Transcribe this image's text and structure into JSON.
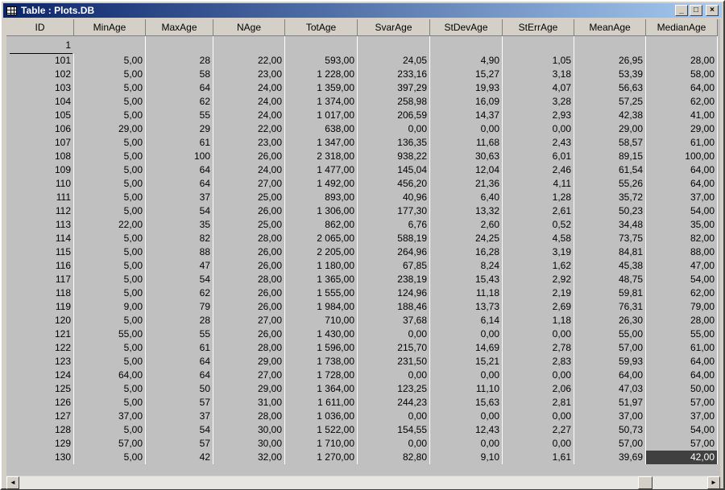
{
  "window": {
    "title": "Table : Plots.DB",
    "minimize": "_",
    "maximize": "□",
    "close": "×"
  },
  "table": {
    "columns": [
      "ID",
      "MinAge",
      "MaxAge",
      "NAge",
      "TotAge",
      "SvarAge",
      "StDevAge",
      "StErrAge",
      "MeanAge",
      "MedianAge"
    ],
    "id_header_value": "1",
    "rows": [
      [
        "101",
        "5,00",
        "28",
        "22,00",
        "593,00",
        "24,05",
        "4,90",
        "1,05",
        "26,95",
        "28,00"
      ],
      [
        "102",
        "5,00",
        "58",
        "23,00",
        "1 228,00",
        "233,16",
        "15,27",
        "3,18",
        "53,39",
        "58,00"
      ],
      [
        "103",
        "5,00",
        "64",
        "24,00",
        "1 359,00",
        "397,29",
        "19,93",
        "4,07",
        "56,63",
        "64,00"
      ],
      [
        "104",
        "5,00",
        "62",
        "24,00",
        "1 374,00",
        "258,98",
        "16,09",
        "3,28",
        "57,25",
        "62,00"
      ],
      [
        "105",
        "5,00",
        "55",
        "24,00",
        "1 017,00",
        "206,59",
        "14,37",
        "2,93",
        "42,38",
        "41,00"
      ],
      [
        "106",
        "29,00",
        "29",
        "22,00",
        "638,00",
        "0,00",
        "0,00",
        "0,00",
        "29,00",
        "29,00"
      ],
      [
        "107",
        "5,00",
        "61",
        "23,00",
        "1 347,00",
        "136,35",
        "11,68",
        "2,43",
        "58,57",
        "61,00"
      ],
      [
        "108",
        "5,00",
        "100",
        "26,00",
        "2 318,00",
        "938,22",
        "30,63",
        "6,01",
        "89,15",
        "100,00"
      ],
      [
        "109",
        "5,00",
        "64",
        "24,00",
        "1 477,00",
        "145,04",
        "12,04",
        "2,46",
        "61,54",
        "64,00"
      ],
      [
        "110",
        "5,00",
        "64",
        "27,00",
        "1 492,00",
        "456,20",
        "21,36",
        "4,11",
        "55,26",
        "64,00"
      ],
      [
        "111",
        "5,00",
        "37",
        "25,00",
        "893,00",
        "40,96",
        "6,40",
        "1,28",
        "35,72",
        "37,00"
      ],
      [
        "112",
        "5,00",
        "54",
        "26,00",
        "1 306,00",
        "177,30",
        "13,32",
        "2,61",
        "50,23",
        "54,00"
      ],
      [
        "113",
        "22,00",
        "35",
        "25,00",
        "862,00",
        "6,76",
        "2,60",
        "0,52",
        "34,48",
        "35,00"
      ],
      [
        "114",
        "5,00",
        "82",
        "28,00",
        "2 065,00",
        "588,19",
        "24,25",
        "4,58",
        "73,75",
        "82,00"
      ],
      [
        "115",
        "5,00",
        "88",
        "26,00",
        "2 205,00",
        "264,96",
        "16,28",
        "3,19",
        "84,81",
        "88,00"
      ],
      [
        "116",
        "5,00",
        "47",
        "26,00",
        "1 180,00",
        "67,85",
        "8,24",
        "1,62",
        "45,38",
        "47,00"
      ],
      [
        "117",
        "5,00",
        "54",
        "28,00",
        "1 365,00",
        "238,19",
        "15,43",
        "2,92",
        "48,75",
        "54,00"
      ],
      [
        "118",
        "5,00",
        "62",
        "26,00",
        "1 555,00",
        "124,96",
        "11,18",
        "2,19",
        "59,81",
        "62,00"
      ],
      [
        "119",
        "9,00",
        "79",
        "26,00",
        "1 984,00",
        "188,46",
        "13,73",
        "2,69",
        "76,31",
        "79,00"
      ],
      [
        "120",
        "5,00",
        "28",
        "27,00",
        "710,00",
        "37,68",
        "6,14",
        "1,18",
        "26,30",
        "28,00"
      ],
      [
        "121",
        "55,00",
        "55",
        "26,00",
        "1 430,00",
        "0,00",
        "0,00",
        "0,00",
        "55,00",
        "55,00"
      ],
      [
        "122",
        "5,00",
        "61",
        "28,00",
        "1 596,00",
        "215,70",
        "14,69",
        "2,78",
        "57,00",
        "61,00"
      ],
      [
        "123",
        "5,00",
        "64",
        "29,00",
        "1 738,00",
        "231,50",
        "15,21",
        "2,83",
        "59,93",
        "64,00"
      ],
      [
        "124",
        "64,00",
        "64",
        "27,00",
        "1 728,00",
        "0,00",
        "0,00",
        "0,00",
        "64,00",
        "64,00"
      ],
      [
        "125",
        "5,00",
        "50",
        "29,00",
        "1 364,00",
        "123,25",
        "11,10",
        "2,06",
        "47,03",
        "50,00"
      ],
      [
        "126",
        "5,00",
        "57",
        "31,00",
        "1 611,00",
        "244,23",
        "15,63",
        "2,81",
        "51,97",
        "57,00"
      ],
      [
        "127",
        "37,00",
        "37",
        "28,00",
        "1 036,00",
        "0,00",
        "0,00",
        "0,00",
        "37,00",
        "37,00"
      ],
      [
        "128",
        "5,00",
        "54",
        "30,00",
        "1 522,00",
        "154,55",
        "12,43",
        "2,27",
        "50,73",
        "54,00"
      ],
      [
        "129",
        "57,00",
        "57",
        "30,00",
        "1 710,00",
        "0,00",
        "0,00",
        "0,00",
        "57,00",
        "57,00"
      ],
      [
        "130",
        "5,00",
        "42",
        "32,00",
        "1 270,00",
        "82,80",
        "9,10",
        "1,61",
        "39,69",
        "42,00"
      ]
    ],
    "selected_cell": {
      "row": 29,
      "col": 9
    }
  },
  "scrollbar": {
    "left_arrow": "◄",
    "right_arrow": "►"
  }
}
